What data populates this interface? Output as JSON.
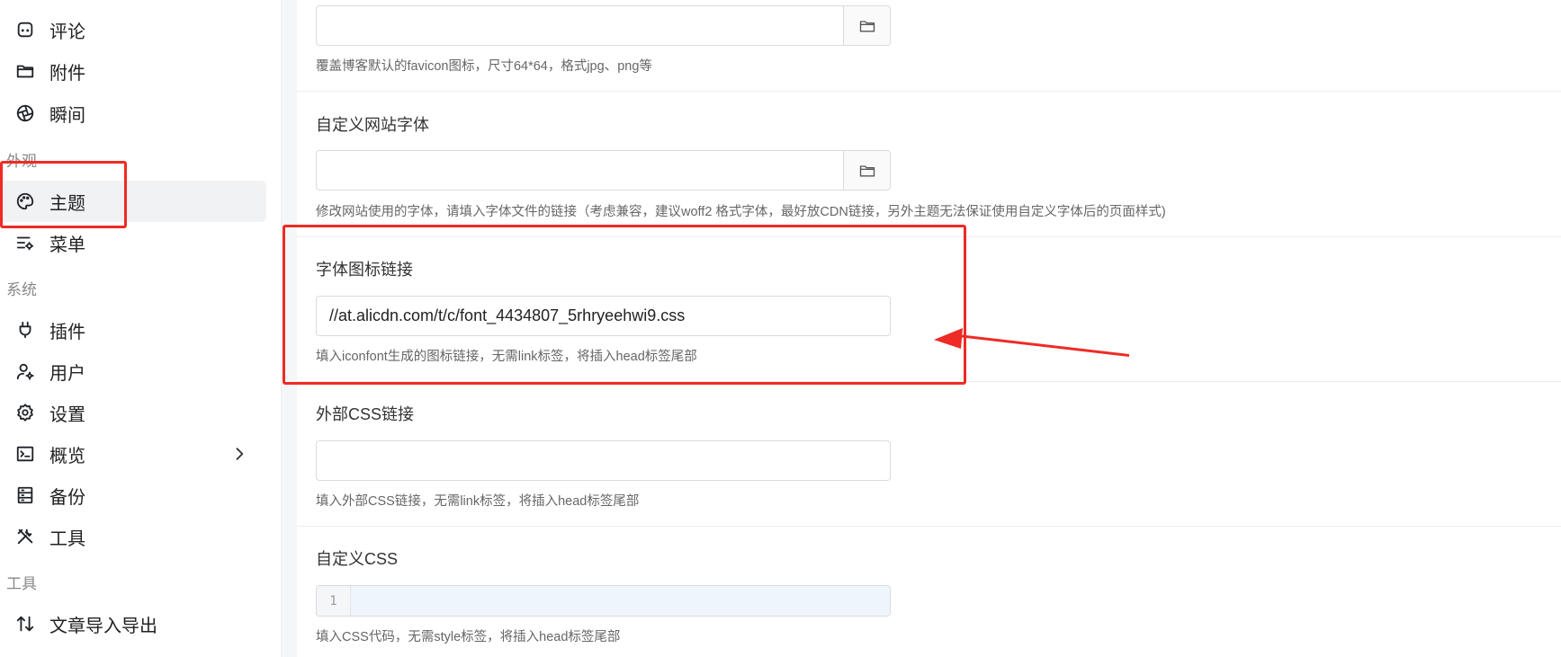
{
  "sidebar": {
    "items": [
      {
        "label": "评论",
        "icon": "comment-icon"
      },
      {
        "label": "附件",
        "icon": "folder-icon"
      },
      {
        "label": "瞬间",
        "icon": "aperture-icon"
      },
      {
        "label": "主题",
        "icon": "palette-icon",
        "active": true
      },
      {
        "label": "菜单",
        "icon": "menu-settings-icon"
      },
      {
        "label": "插件",
        "icon": "plug-icon"
      },
      {
        "label": "用户",
        "icon": "user-settings-icon"
      },
      {
        "label": "设置",
        "icon": "gear-icon"
      },
      {
        "label": "概览",
        "icon": "terminal-icon",
        "has_submenu": true
      },
      {
        "label": "备份",
        "icon": "database-icon"
      },
      {
        "label": "工具",
        "icon": "tools-icon"
      },
      {
        "label": "文章导入导出",
        "icon": "sort-arrows-icon"
      }
    ],
    "groups": {
      "appearance": "外观",
      "system": "系统",
      "tools": "工具"
    }
  },
  "form": {
    "favicon": {
      "value": "",
      "help": "覆盖博客默认的favicon图标，尺寸64*64，格式jpg、png等"
    },
    "font": {
      "label": "自定义网站字体",
      "value": "",
      "help": "修改网站使用的字体，请填入字体文件的链接（考虑兼容，建议woff2 格式字体，最好放CDN链接，另外主题无法保证使用自定义字体后的页面样式)"
    },
    "iconfont": {
      "label": "字体图标链接",
      "value": "//at.alicdn.com/t/c/font_4434807_5rhryeehwi9.css",
      "help": "填入iconfont生成的图标链接，无需link标签，将插入head标签尾部"
    },
    "external_css": {
      "label": "外部CSS链接",
      "value": "",
      "help": "填入外部CSS链接，无需link标签，将插入head标签尾部"
    },
    "custom_css": {
      "label": "自定义CSS",
      "line_number": "1",
      "help": "填入CSS代码，无需style标签，将插入head标签尾部"
    }
  },
  "colors": {
    "annotation": "#ee2b24",
    "active_bg": "#f1f2f4"
  }
}
